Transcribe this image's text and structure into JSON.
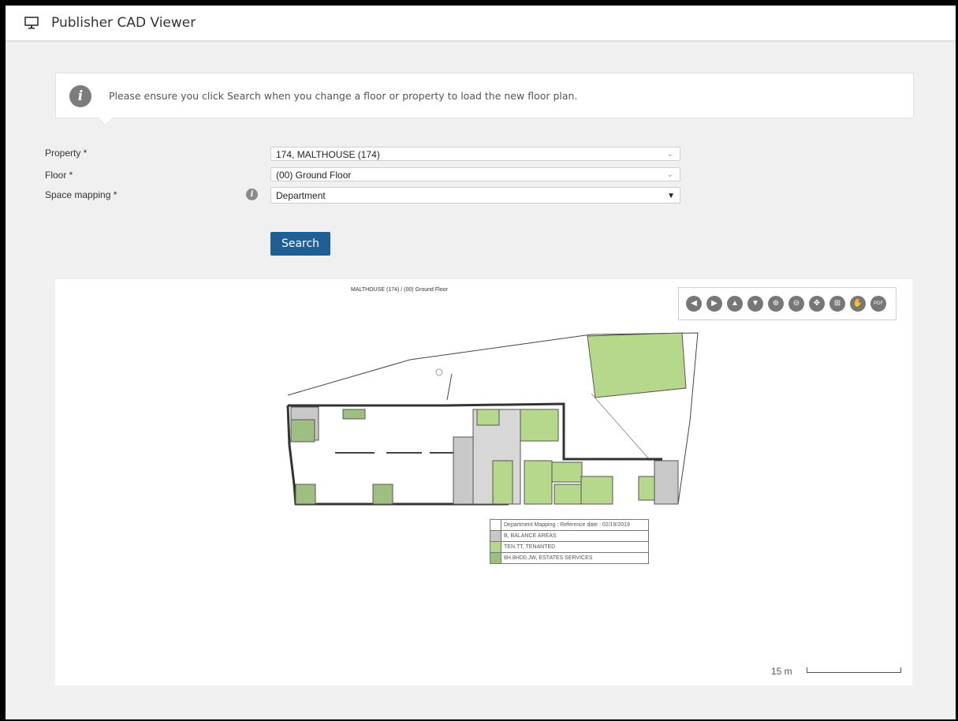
{
  "app": {
    "title": "Publisher CAD Viewer",
    "icon": "monitor-icon"
  },
  "info": {
    "message": "Please ensure you click Search when you change a floor or property to load the new floor plan.",
    "icon": "info-icon"
  },
  "form": {
    "property": {
      "label": "Property *",
      "value": "174, MALTHOUSE (174)"
    },
    "floor": {
      "label": "Floor *",
      "value": "(00) Ground Floor"
    },
    "space_mapping": {
      "label": "Space mapping *",
      "value": "Department"
    },
    "search_label": "Search"
  },
  "viewer": {
    "plan_title": "MALTHOUSE (174) / (00) Ground Floor",
    "toolbar": [
      "pan-left-icon",
      "pan-right-icon",
      "pan-up-icon",
      "pan-down-icon",
      "zoom-in-icon",
      "zoom-out-icon",
      "fit-icon",
      "extent-icon",
      "hand-icon",
      "pdf-icon"
    ],
    "legend": {
      "header": "Department Mapping : Reference date : 02/19/2019",
      "items": [
        {
          "label": "B, BALANCE AREAS",
          "color": "#c8c8c8"
        },
        {
          "label": "TEN.TT, TENANTED",
          "color": "#b5d88b"
        },
        {
          "label": "8H.8HD0.JW, ESTATES SERVICES",
          "color": "#9ebf80"
        }
      ]
    },
    "scale_label": "15 m"
  },
  "colors": {
    "accent": "#1f5f94",
    "tenant": "#b5d88b",
    "estates": "#9ebf80",
    "balance": "#c8c8c8"
  }
}
